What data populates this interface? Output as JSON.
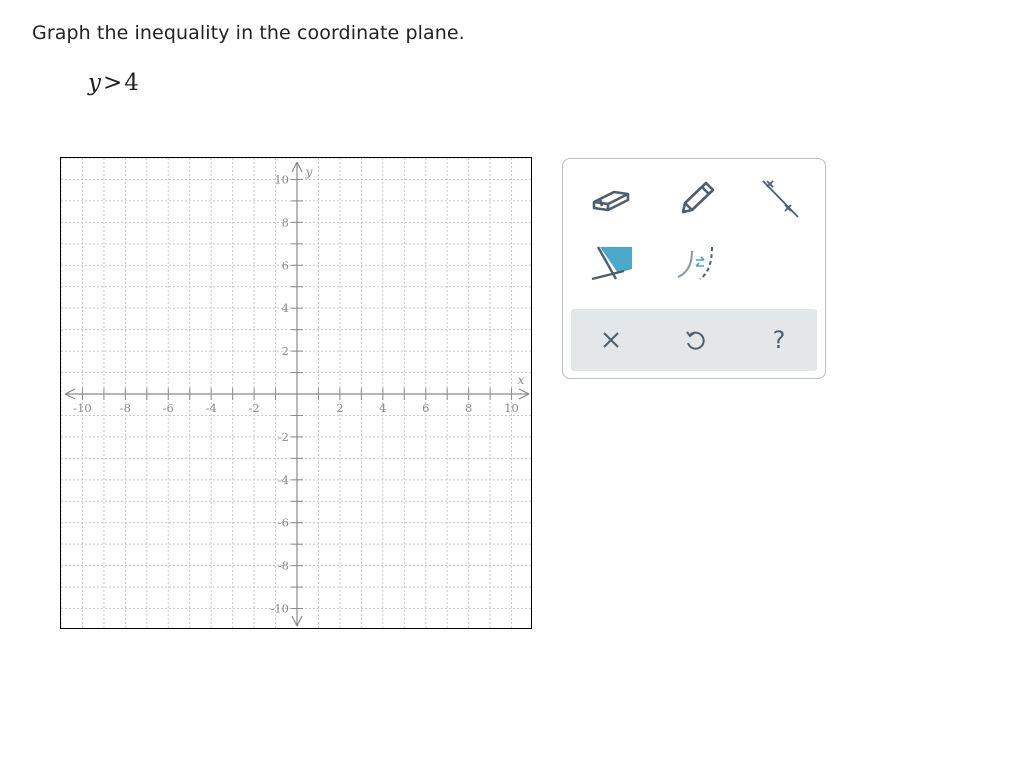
{
  "question": {
    "prompt": "Graph the inequality in the coordinate plane.",
    "inequality": {
      "var": "y",
      "op": ">",
      "value": "4"
    }
  },
  "graph": {
    "x_axis_label": "x",
    "y_axis_label": "y",
    "x_range": [
      -11,
      11
    ],
    "y_range": [
      -11,
      11
    ],
    "grid_step": 1,
    "x_tick_labels": [
      "-10",
      "-8",
      "-6",
      "-4",
      "-2",
      "2",
      "4",
      "6",
      "8",
      "10"
    ],
    "y_tick_labels": [
      "10",
      "8",
      "6",
      "4",
      "2",
      "-2",
      "-4",
      "-6",
      "-8",
      "-10"
    ]
  },
  "toolbox": {
    "tools": [
      {
        "name": "eraser",
        "icon": "eraser-icon"
      },
      {
        "name": "pencil",
        "icon": "pencil-icon"
      },
      {
        "name": "line",
        "icon": "line-tool-icon"
      },
      {
        "name": "shade-region",
        "icon": "shade-region-icon"
      },
      {
        "name": "solid-dashed-toggle",
        "icon": "solid-dashed-toggle-icon"
      }
    ],
    "actions": [
      {
        "name": "clear",
        "icon": "close-icon"
      },
      {
        "name": "undo",
        "icon": "undo-icon"
      },
      {
        "name": "help",
        "icon": "help-icon",
        "label": "?"
      }
    ],
    "colors": {
      "accent": "#4aa8c9",
      "icon": "#4e5e6c",
      "bar": "#e3e7ea"
    }
  }
}
